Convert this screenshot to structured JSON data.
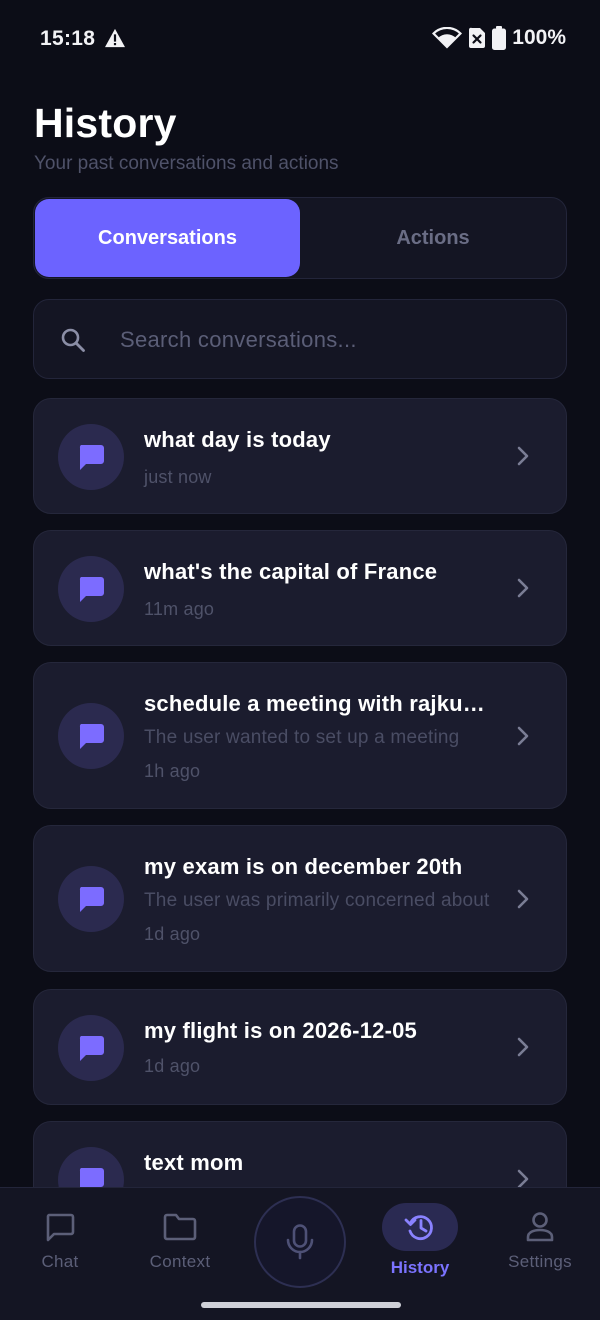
{
  "status_bar": {
    "time": "15:18",
    "battery": "100%",
    "icons": [
      "warning-icon",
      "wifi-icon",
      "no-sim-icon",
      "battery-icon"
    ]
  },
  "header": {
    "title": "History",
    "subtitle": "Your past conversations and actions"
  },
  "tabs": [
    {
      "label": "Conversations",
      "active": true
    },
    {
      "label": "Actions",
      "active": false
    }
  ],
  "search": {
    "placeholder": "Search conversations...",
    "value": ""
  },
  "conversations": [
    {
      "title": "what day is today",
      "summary": "",
      "time": "just now"
    },
    {
      "title": "what's the capital of France",
      "summary": "",
      "time": "11m ago"
    },
    {
      "title": "schedule a meeting with rajkumar",
      "summary": "The user wanted to set up a meeting",
      "time": "1h ago"
    },
    {
      "title": "my exam is on december 20th",
      "summary": "The user was primarily concerned about",
      "time": "1d ago"
    },
    {
      "title": "my flight is on 2026-12-05",
      "summary": "",
      "time": "1d ago"
    },
    {
      "title": "text mom",
      "summary": "",
      "time": ""
    }
  ],
  "nav": {
    "chat": "Chat",
    "context": "Context",
    "history": "History",
    "settings": "Settings",
    "active": "History"
  },
  "colors": {
    "background": "#0c0d17",
    "card": "#1b1c2e",
    "accent": "#6c63ff",
    "accent_text": "#7b73ff",
    "muted_text": "#4f5269"
  }
}
